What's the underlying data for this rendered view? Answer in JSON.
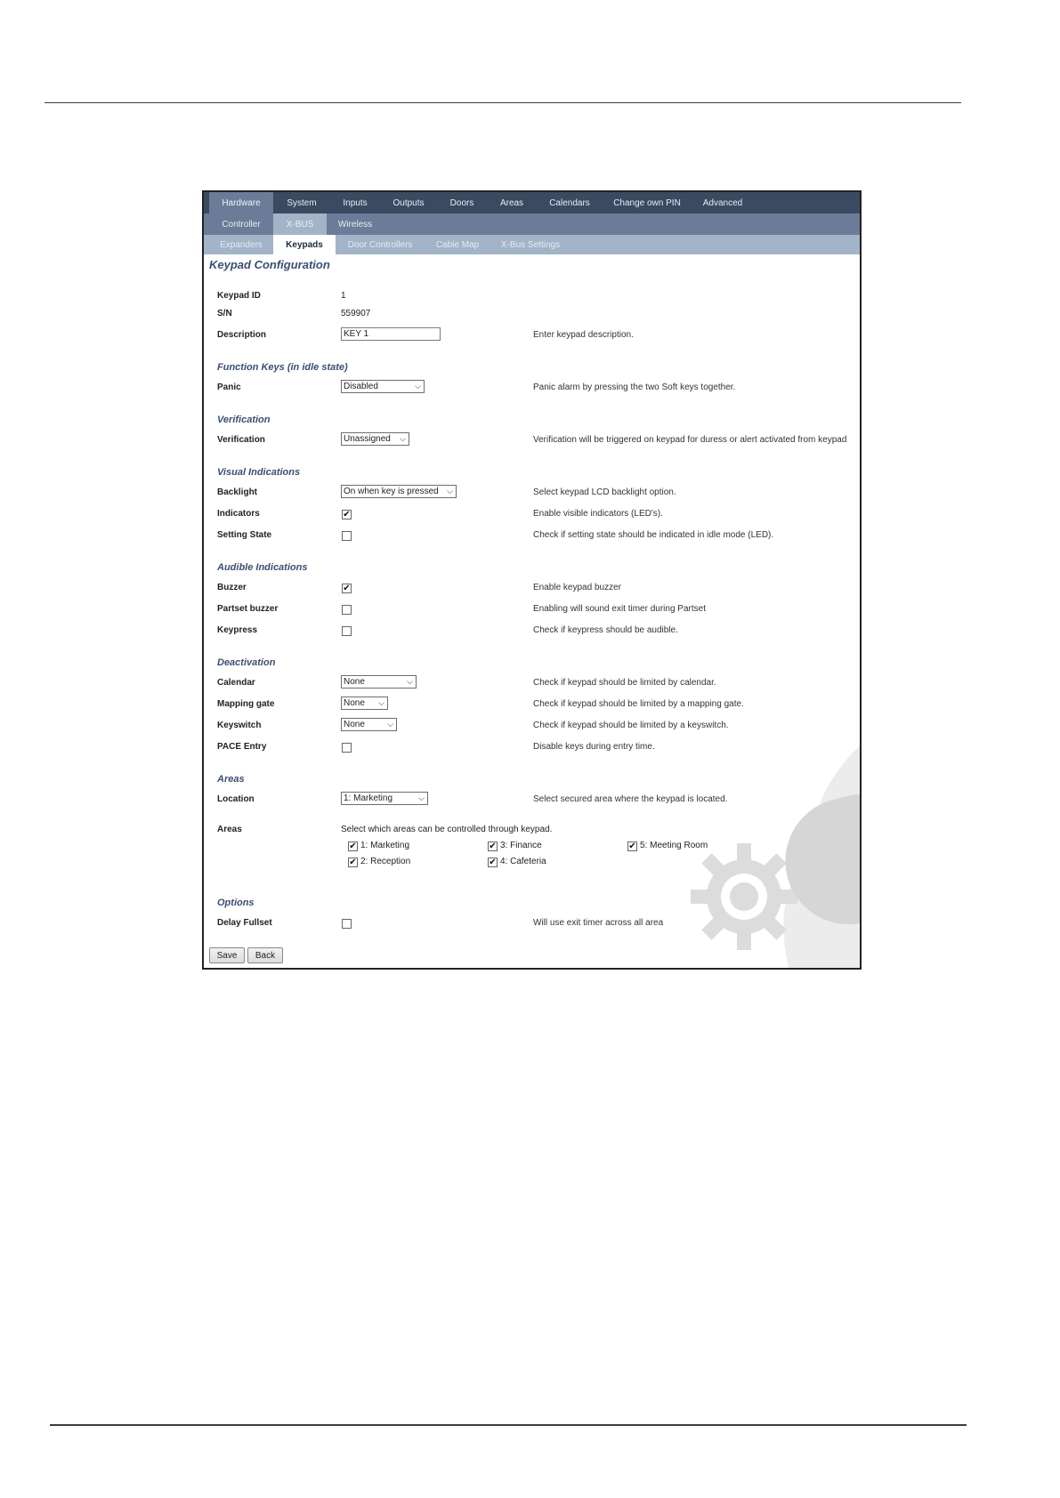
{
  "nav": {
    "main": [
      "Hardware",
      "System",
      "Inputs",
      "Outputs",
      "Doors",
      "Areas",
      "Calendars",
      "Change own PIN",
      "Advanced"
    ],
    "sub": [
      "Controller",
      "X-BUS",
      "Wireless"
    ],
    "sub2": [
      "Expanders",
      "Keypads",
      "Door Controllers",
      "Cable Map",
      "X-Bus Settings"
    ]
  },
  "page": {
    "title": "Keypad Configuration"
  },
  "general": {
    "keypad_id_label": "Keypad ID",
    "keypad_id_value": "1",
    "sn_label": "S/N",
    "sn_value": "559907",
    "description_label": "Description",
    "description_value": "KEY 1",
    "description_help": "Enter keypad description."
  },
  "function_keys": {
    "title": "Function Keys (in idle state)",
    "panic_label": "Panic",
    "panic_value": "Disabled",
    "panic_help": "Panic alarm by pressing the two Soft keys together."
  },
  "verification": {
    "title": "Verification",
    "label": "Verification",
    "value": "Unassigned",
    "help": "Verification will be triggered on keypad for duress or alert activated from keypad"
  },
  "visual": {
    "title": "Visual Indications",
    "backlight_label": "Backlight",
    "backlight_value": "On when key is pressed",
    "backlight_help": "Select keypad LCD backlight option.",
    "indicators_label": "Indicators",
    "indicators_checked": true,
    "indicators_help": "Enable visible indicators (LED's).",
    "setting_state_label": "Setting State",
    "setting_state_checked": false,
    "setting_state_help": "Check if setting state should be indicated in idle mode (LED)."
  },
  "audible": {
    "title": "Audible Indications",
    "buzzer_label": "Buzzer",
    "buzzer_checked": true,
    "buzzer_help": "Enable keypad buzzer",
    "partset_label": "Partset buzzer",
    "partset_checked": false,
    "partset_help": "Enabling will sound exit timer during Partset",
    "keypress_label": "Keypress",
    "keypress_checked": false,
    "keypress_help": "Check if keypress should be audible."
  },
  "deactivation": {
    "title": "Deactivation",
    "calendar_label": "Calendar",
    "calendar_value": "None",
    "calendar_help": "Check if keypad should be limited by calendar.",
    "mapping_label": "Mapping gate",
    "mapping_value": "None",
    "mapping_help": "Check if keypad should be limited by a mapping gate.",
    "keyswitch_label": "Keyswitch",
    "keyswitch_value": "None",
    "keyswitch_help": "Check if keypad should be limited by a keyswitch.",
    "pace_label": "PACE Entry",
    "pace_checked": false,
    "pace_help": "Disable keys during entry time."
  },
  "areas": {
    "title": "Areas",
    "location_label": "Location",
    "location_value": "1: Marketing",
    "location_help": "Select secured area where the keypad is located.",
    "areas_label": "Areas",
    "areas_help": "Select which areas can be controlled through keypad.",
    "items": [
      {
        "label": "1: Marketing",
        "checked": true
      },
      {
        "label": "2: Reception",
        "checked": true
      },
      {
        "label": "3: Finance",
        "checked": true
      },
      {
        "label": "4: Cafeteria",
        "checked": true
      },
      {
        "label": "5: Meeting Room",
        "checked": true
      }
    ]
  },
  "options": {
    "title": "Options",
    "delay_label": "Delay Fullset",
    "delay_checked": false,
    "delay_help": "Will use exit timer across all area"
  },
  "buttons": {
    "save": "Save",
    "back": "Back"
  },
  "icons": {
    "checkbox_check": "✔",
    "select_chevron": "⌵"
  }
}
